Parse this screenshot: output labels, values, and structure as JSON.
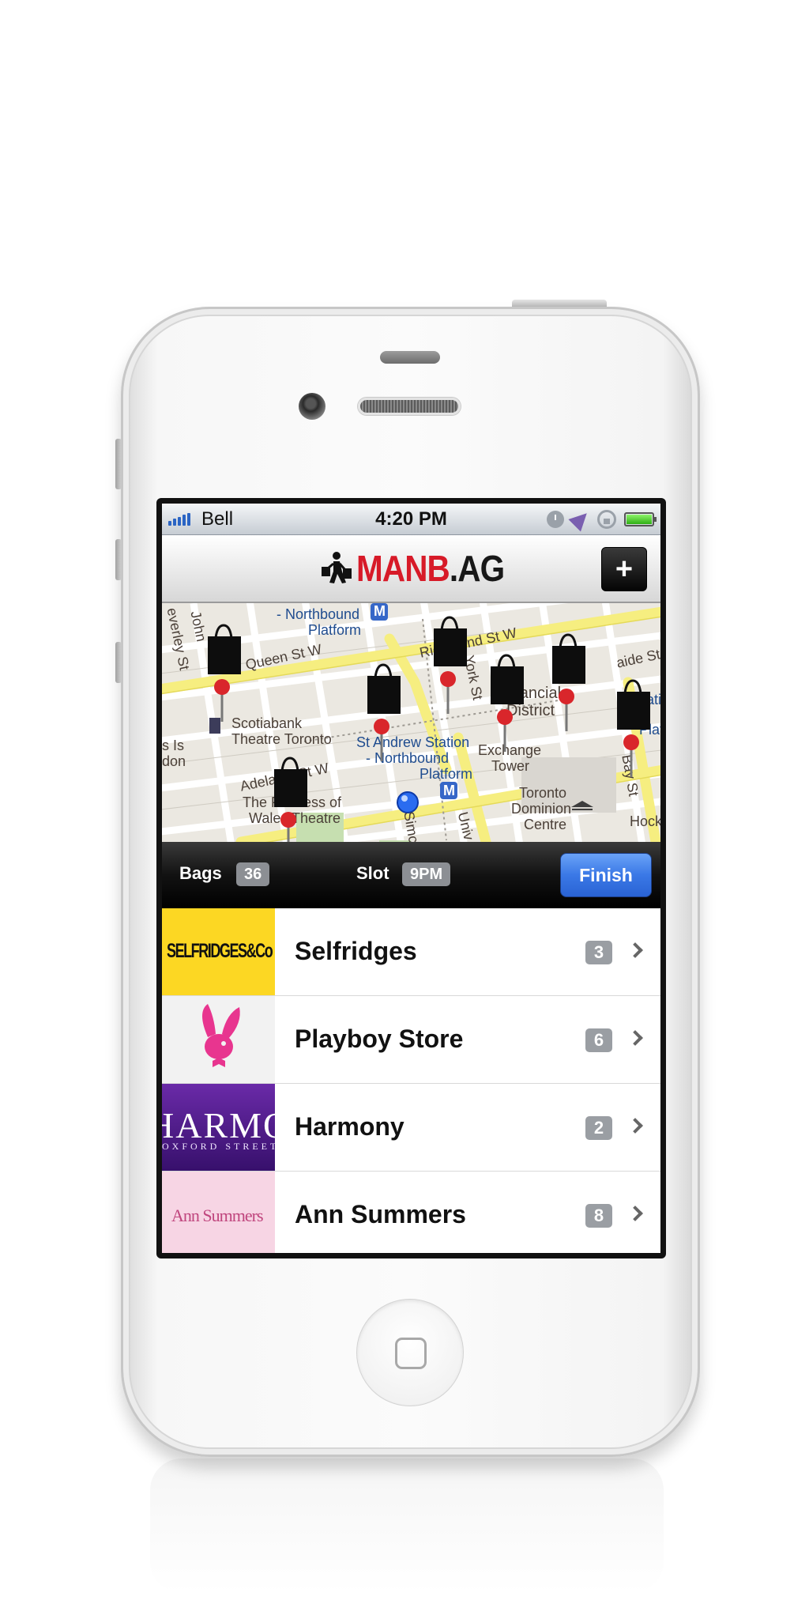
{
  "status_bar": {
    "carrier": "Bell",
    "time": "4:20 PM"
  },
  "nav": {
    "logo_part1": "MANB",
    "logo_part2": ".AG",
    "add_label": "+"
  },
  "map": {
    "labels": {
      "l1": "John",
      "l2": "everley St",
      "l3": "- Northbound",
      "l4": "Platform",
      "l5": "Queen St W",
      "l6": "Richmond St W",
      "l7": "aide St",
      "l8": "Scotiabank",
      "l9": "Theatre Toronto",
      "l10": "Financial",
      "l11": "District",
      "l12": "York St",
      "l13": "St Andrew Station",
      "l14": "- Northbound",
      "l15": "Platform",
      "l16": "Exchange",
      "l17": "Tower",
      "l18": "Adelaide St W",
      "l19": "s Is",
      "l20": "don",
      "l21": "The Princess of",
      "l22": "Wales Theatre",
      "l23": "Toronto",
      "l24": "Dominion",
      "l25": "Centre",
      "l26": "Simcoe",
      "l27": "Univ",
      "l28": "Bay St",
      "l29": "Hock",
      "l30": "Station",
      "l31": "Platf",
      "l32": "M",
      "l33": "M"
    }
  },
  "toolbar": {
    "bags_label": "Bags",
    "bags_count": "36",
    "slot_label": "Slot",
    "slot_value": "9PM",
    "finish_label": "Finish"
  },
  "stores": [
    {
      "name": "Selfridges",
      "count": "3",
      "logo_text": "SELFRIDGES&Co"
    },
    {
      "name": "Playboy Store",
      "count": "6"
    },
    {
      "name": "Harmony",
      "count": "2",
      "logo_text": "HARMONY",
      "logo_sub": "OXFORD STREET"
    },
    {
      "name": "Ann Summers",
      "count": "8",
      "logo_text": "Ann Summers"
    }
  ],
  "colors": {
    "brand_red": "#d71a28",
    "finish_blue": "#3a78e6",
    "badge_gray": "#8c8f94"
  }
}
